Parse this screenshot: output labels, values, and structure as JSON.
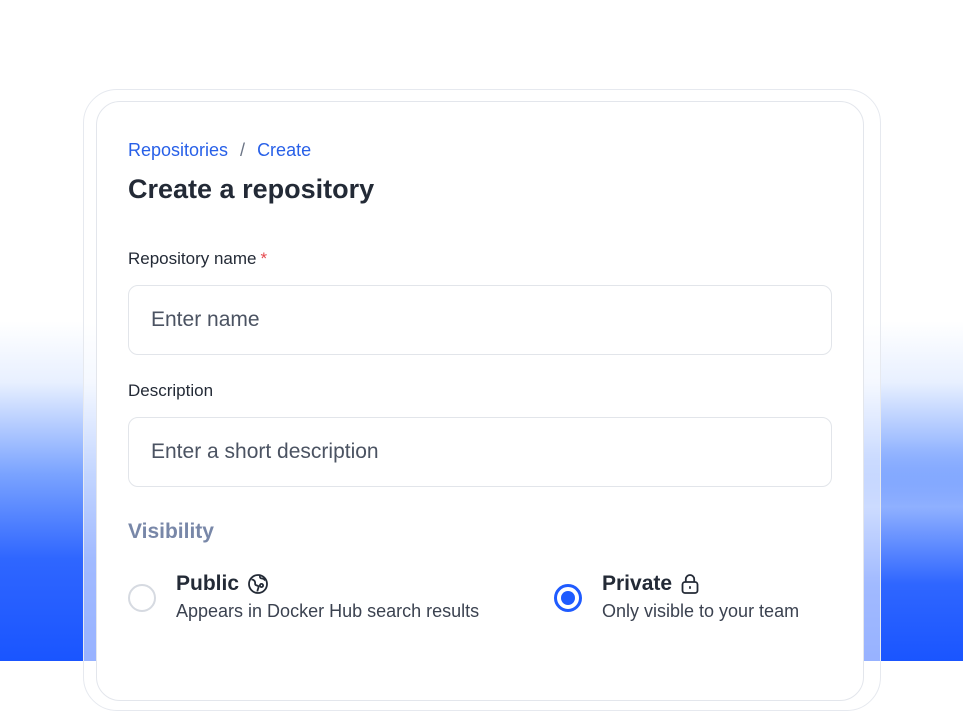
{
  "breadcrumb": {
    "root": "Repositories",
    "separator": "/",
    "current": "Create"
  },
  "page_title": "Create a repository",
  "form": {
    "name_label": "Repository name",
    "required_mark": "*",
    "name_placeholder": "Enter name",
    "description_label": "Description",
    "description_placeholder": "Enter a short description",
    "visibility_label": "Visibility",
    "options": [
      {
        "title": "Public",
        "desc": "Appears in Docker Hub search results",
        "icon": "globe-icon",
        "selected": false
      },
      {
        "title": "Private",
        "desc": "Only visible to your team",
        "icon": "lock-icon",
        "selected": true
      }
    ]
  },
  "colors": {
    "accent": "#1f5bff",
    "link": "#2860e8",
    "required": "#e5484d",
    "visibility_label": "#7887a8"
  }
}
